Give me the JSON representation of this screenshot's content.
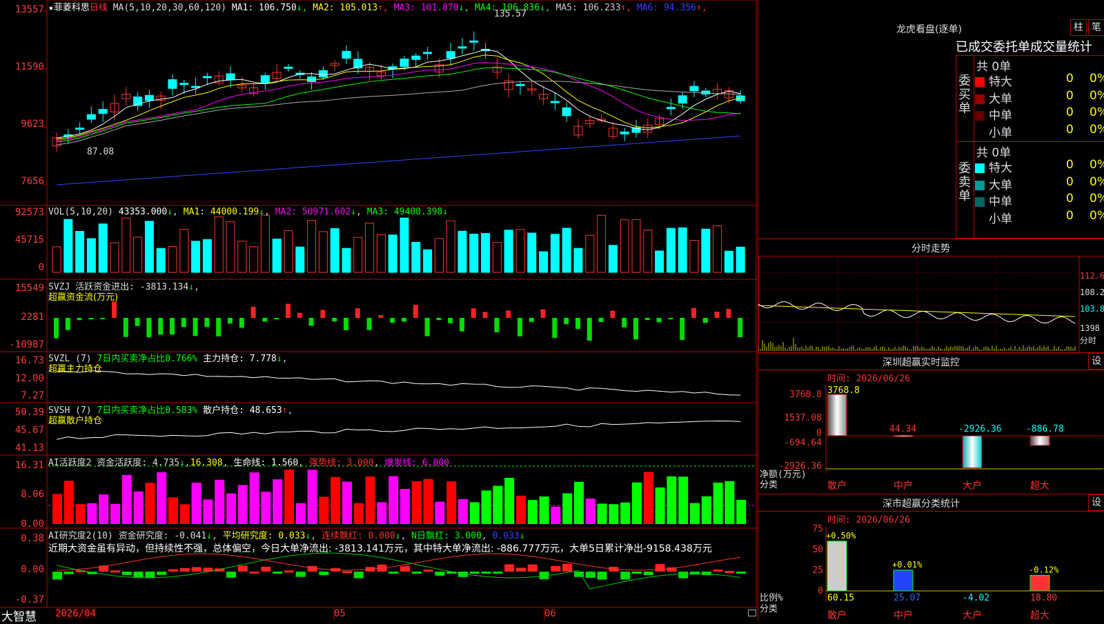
{
  "main": {
    "header": {
      "star": "★",
      "name": "菲菱科思",
      "period": "日线",
      "ma_label": "MA(5,10,20,30,60,120)",
      "ma": [
        {
          "label": "MA1: 106.750",
          "arrow": "↓",
          "color": "#ffffff"
        },
        {
          "label": "MA2: 105.013",
          "arrow": "↑",
          "color": "#ffff00"
        },
        {
          "label": "MA3: 101.870",
          "arrow": "↓",
          "color": "#ff00ff"
        },
        {
          "label": "MA4: 106.836",
          "arrow": "↓",
          "color": "#00ff00"
        },
        {
          "label": "MA5: 106.233",
          "arrow": "↑",
          "color": "#cccccc"
        },
        {
          "label": "MA6: 94.356",
          "arrow": "↑",
          "color": "#3344ff"
        }
      ],
      "high_mark": "135.57",
      "low_mark": "87.08"
    },
    "price_axis": [
      "13557",
      "11590",
      "9623",
      "7656"
    ],
    "vol": {
      "header": "VOL(5,10,20)",
      "value": "43353.000",
      "arrow": "↓",
      "ma1": "MA1: 44000.199",
      "ma2": "MA2: 50971.602",
      "ma3": "MA3: 49400.398",
      "axis": [
        "92573",
        "45715",
        "0"
      ]
    },
    "svzj": {
      "header": "SVZJ  活跃资金进出: -3813.134",
      "arrow": "↓",
      "sub": "超赢资金流(万元)",
      "axis": [
        "15549",
        "2281",
        "-10987"
      ]
    },
    "svzl": {
      "header": "SVZL (7)",
      "green": "7日内买卖净占比0.766%",
      "main": "主力持仓: 7.778",
      "arrow": "↓",
      "sub": "超赢主力持仓",
      "axis": [
        "16.73",
        "12.00",
        "7.27"
      ]
    },
    "svsh": {
      "header": "SVSH (7)",
      "green": "7日内买卖净占比0.583%",
      "main": "散户持仓: 48.653",
      "arrow": "↑",
      "sub": "超赢散户持仓",
      "axis": [
        "50.39",
        "45.67",
        "41.13"
      ]
    },
    "ai_active": {
      "header": "AI活跃度2 资金活跃度: 4.735",
      "v2": "16.308",
      "life": "生命线: 1.560",
      "strong": "强势线: 3.000",
      "burst": "爆发线: 6.000",
      "axis": [
        "16.31",
        "8.06",
        "0.00"
      ]
    },
    "ai_research": {
      "header": "AI研究度2(10) 资金研究度: -0.041",
      "avg": "平均研究度: 0.033",
      "red": "连续飘红: 0.000",
      "nred": "N日飘红: 3.000",
      "blue": "0.033",
      "comment": "近期大资金虽有异动，但持续性不强，总体偏空，今日大单净流出: -3813.141万元，其中特大单净流出: -886.777万元，大单5日累计净出-9158.438万元",
      "axis": [
        "0.38",
        "0.00",
        "-0.37"
      ]
    },
    "bottom": {
      "brand": "大智慧",
      "date": "2026/04",
      "m5": "05",
      "m6": "06"
    }
  },
  "right": {
    "dragon": {
      "title": "龙虎看盘(逐单)",
      "btn1": "柱",
      "btn2": "笔",
      "subtitle": "已成交委托单成交量统计",
      "buy_label": "委买单",
      "sell_label": "委卖单",
      "buy_total": "共 0单",
      "sell_total": "共 0单",
      "buy_rows": [
        {
          "name": "特大",
          "v": "0",
          "p": "0%",
          "color": "#ff0000"
        },
        {
          "name": "大单",
          "v": "0",
          "p": "0%",
          "color": "#990000"
        },
        {
          "name": "中单",
          "v": "0",
          "p": "0%",
          "color": "#660000"
        },
        {
          "name": "小单",
          "v": "0",
          "p": "0%",
          "color": "#000000"
        }
      ],
      "sell_rows": [
        {
          "name": "特大",
          "v": "0",
          "p": "0%",
          "color": "#00ffff"
        },
        {
          "name": "大单",
          "v": "0",
          "p": "0%",
          "color": "#009999"
        },
        {
          "name": "中单",
          "v": "0",
          "p": "0%",
          "color": "#006666"
        },
        {
          "name": "小单",
          "v": "0",
          "p": "0%",
          "color": "#000000"
        }
      ]
    },
    "intraday": {
      "title": "分时走势",
      "axis": [
        "112.6",
        "108.2",
        "103.8"
      ],
      "vol_axis": "1398",
      "time_label": "分时"
    },
    "monitor": {
      "title": "深圳超赢实时监控",
      "btn": "设",
      "time": "时间: 2026/06/26",
      "axis": [
        "3768.8",
        "1537.08",
        "0",
        "-694.64",
        "-2926.36"
      ],
      "unit1": "净额(万元)",
      "unit2": "分类",
      "cats": [
        "散户",
        "中户",
        "大户",
        "超大"
      ],
      "labels": [
        "3768.8",
        "44.34",
        "-2926.36",
        "-886.78"
      ]
    },
    "classify": {
      "title": "深市超赢分类统计",
      "btn": "设",
      "time": "时间: 2026/06/26",
      "axis": [
        "75",
        "50",
        "25",
        "0"
      ],
      "unit1": "比例%",
      "unit2": "分类",
      "cats": [
        "散户",
        "中户",
        "大户",
        "超大"
      ],
      "top_labels": [
        "+0.50%",
        "+0.01%",
        "",
        "-0.12%"
      ],
      "bottom_labels": [
        "60.15",
        "25.07",
        "-4.02",
        "18.80"
      ]
    }
  }
}
